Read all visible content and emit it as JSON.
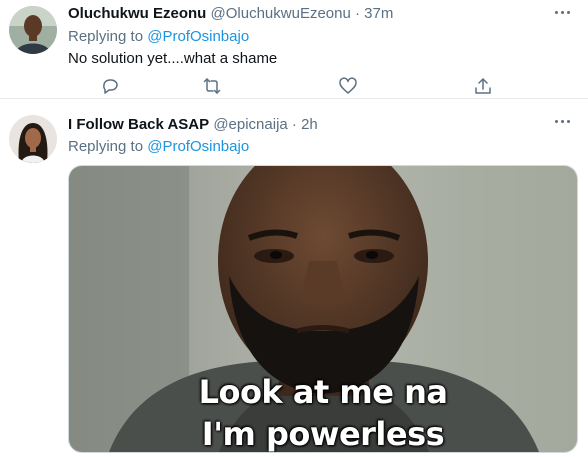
{
  "tweets": [
    {
      "name": "Oluchukwu Ezeonu",
      "handle": "@OluchukwuEzeonu",
      "time": "37m",
      "replying_prefix": "Replying to",
      "replying_to": "@ProfOsinbajo",
      "text": "No solution yet....what a shame"
    },
    {
      "name": "I Follow Back ASAP",
      "handle": "@epicnaija",
      "time": "2h",
      "replying_prefix": "Replying to",
      "replying_to": "@ProfOsinbajo",
      "media_caption_line1": "Look at me na",
      "media_caption_line2": "I'm powerless"
    }
  ],
  "separator": "·",
  "icons": {
    "more": "more-dots-icon",
    "reply": "reply-icon",
    "retweet": "retweet-icon",
    "like": "like-icon",
    "share": "share-icon"
  },
  "colors": {
    "link": "#1b95e0",
    "secondary": "#5b7083",
    "text": "#0f1419",
    "divider": "#e6ecf0"
  }
}
